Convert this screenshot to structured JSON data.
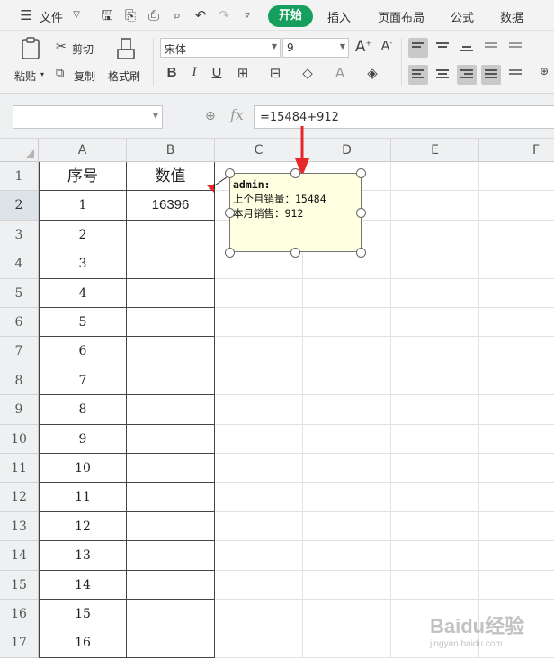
{
  "menubar": {
    "file_label": "文件",
    "tabs": [
      "开始",
      "插入",
      "页面布局",
      "公式",
      "数据"
    ]
  },
  "toolbar": {
    "paste_label": "粘贴",
    "cut_label": "剪切",
    "copy_label": "复制",
    "format_painter_label": "格式刷",
    "font_name": "宋体",
    "font_size": "9"
  },
  "formula_bar": {
    "name_box": "",
    "fx_label": "fx",
    "formula": "=15484+912"
  },
  "grid": {
    "columns": [
      "A",
      "B",
      "C",
      "D",
      "E",
      "F"
    ],
    "rows": [
      "1",
      "2",
      "3",
      "4",
      "5",
      "6",
      "7",
      "8",
      "9",
      "10",
      "11",
      "12",
      "13",
      "14",
      "15",
      "16",
      "17"
    ],
    "header_row": {
      "a": "序号",
      "b": "数值"
    },
    "sequence": [
      "1",
      "2",
      "3",
      "4",
      "5",
      "6",
      "7",
      "8",
      "9",
      "10",
      "11",
      "12",
      "13",
      "14",
      "15",
      "16"
    ],
    "b2_value": "16396"
  },
  "comment": {
    "author": "admin:",
    "line1": "上个月销量：15484",
    "line2": "本月销售：912"
  },
  "watermark": {
    "brand": "Baidu经验",
    "url": "jingyan.baidu.com"
  },
  "colors": {
    "start_tab": "#17a05d",
    "comment_bg": "#ffffe1",
    "red_arrow": "#e8262a",
    "header_bg": "#eef0f1"
  }
}
